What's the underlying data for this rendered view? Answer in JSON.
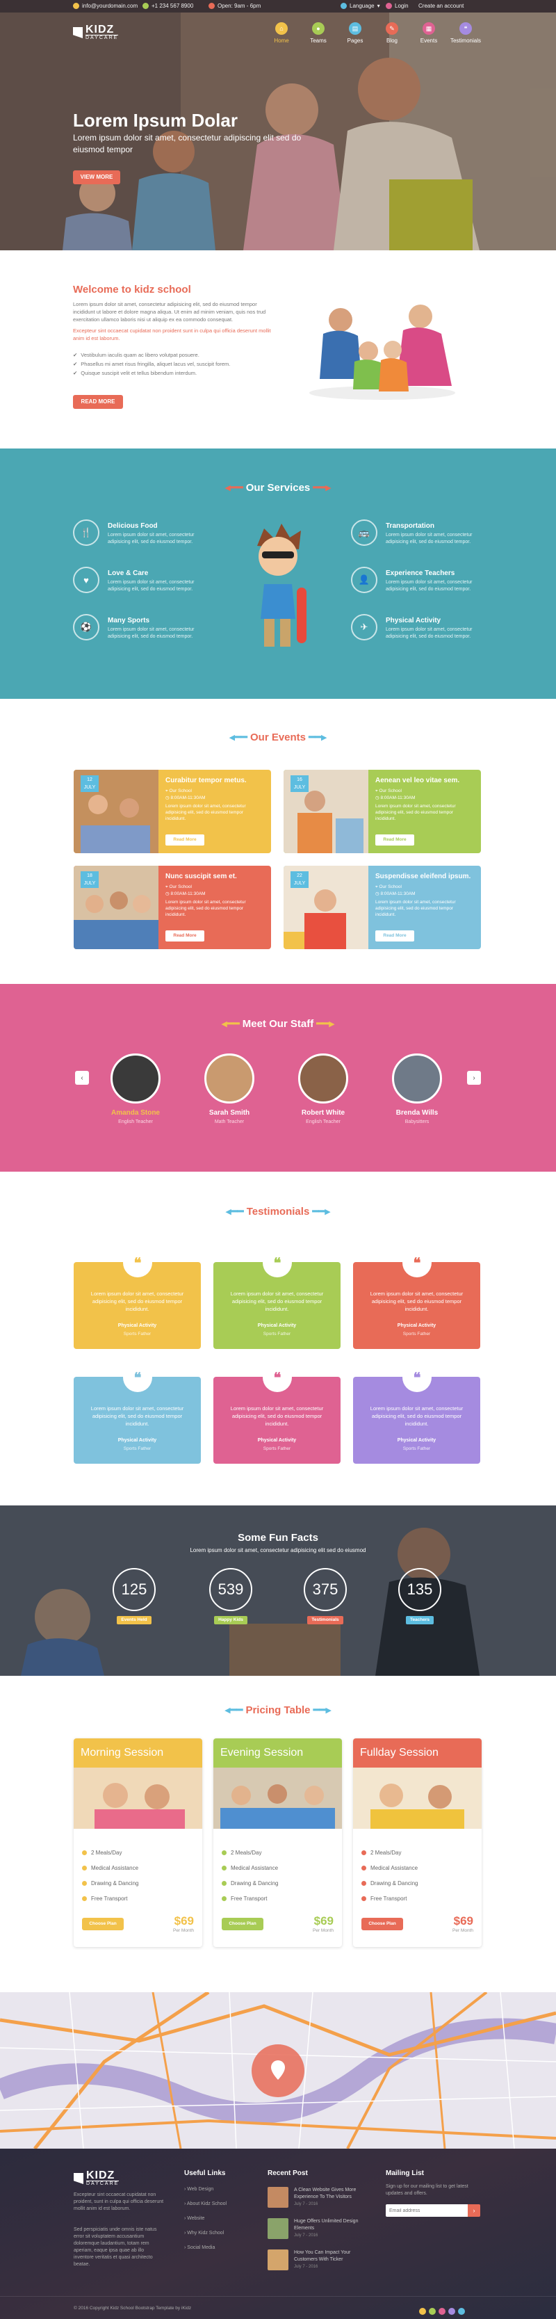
{
  "colors": {
    "red": "#e86b57",
    "teal": "#4ba7b3",
    "pink": "#df6292",
    "yellow": "#f2c24a",
    "green": "#a8cc55",
    "blue": "#7fc2dd",
    "purple": "#a58be0",
    "orange": "#f0a238"
  },
  "topbar": {
    "email": "info@yourdomain.com",
    "phone": "+1 234 567 8900",
    "hours": "Open: 9am - 6pm",
    "language": "Language",
    "login": "Login",
    "create_account": "Create an account"
  },
  "header": {
    "logo_main": "KIDZ",
    "logo_sub": "DAYCARE",
    "nav": [
      {
        "label": "Home",
        "icon": "home-icon"
      },
      {
        "label": "Teams",
        "icon": "users-icon"
      },
      {
        "label": "Pages",
        "icon": "pages-icon"
      },
      {
        "label": "Blog",
        "icon": "blog-icon"
      },
      {
        "label": "Events",
        "icon": "calendar-icon"
      },
      {
        "label": "Testimonials",
        "icon": "quote-icon"
      }
    ]
  },
  "hero": {
    "title": "Lorem Ipsum Dolar",
    "text": "Lorem ipsum dolor sit amet, consectetur adipiscing elit sed do eiusmod tempor",
    "button": "View More"
  },
  "welcome": {
    "title": "Welcome to kidz school",
    "para1": "Lorem ipsum dolor sit amet, consectetur adipisicing elit, sed do eiusmod tempor incididunt ut labore et dolore magna aliqua. Ut enim ad minim veniam, quis nos trud exercitation ullamco laboris nisi ut aliquip ex ea commodo consequat.",
    "para2": "Excepteur sint occaecat cupidatat non proident sunt in culpa qui officia deserunt mollit anim id est laborum.",
    "bullets": [
      "Vestibulum iaculis quam ac libero volutpat posuere.",
      "Phasellus mi amet risus fringilla, aliquet lacus vel, suscipit forem.",
      "Quisque suscipit velit et tellus bibendum interdum."
    ],
    "button": "Read More"
  },
  "services": {
    "title": "Our Services",
    "items": [
      {
        "title": "Delicious Food",
        "desc": "Lorem ipsum dolor sit amet, consectetur adipisicing elit, sed do eiusmod tempor.",
        "icon": "food-icon"
      },
      {
        "title": "Love & Care",
        "desc": "Lorem ipsum dolor sit amet, consectetur adipisicing elit, sed do eiusmod tempor.",
        "icon": "heart-icon"
      },
      {
        "title": "Many Sports",
        "desc": "Lorem ipsum dolor sit amet, consectetur adipisicing elit, sed do eiusmod tempor.",
        "icon": "ball-icon"
      },
      {
        "title": "Transportation",
        "desc": "Lorem ipsum dolor sit amet, consectetur adipisicing elit, sed do eiusmod tempor.",
        "icon": "bus-icon"
      },
      {
        "title": "Experience Teachers",
        "desc": "Lorem ipsum dolor sit amet, consectetur adipisicing elit, sed do eiusmod tempor.",
        "icon": "teacher-icon"
      },
      {
        "title": "Physical Activity",
        "desc": "Lorem ipsum dolor sit amet, consectetur adipisicing elit, sed do eiusmod tempor.",
        "icon": "activity-icon"
      }
    ]
  },
  "events": {
    "title": "Our Events",
    "items": [
      {
        "title": "Curabitur tempor metus.",
        "day": "12",
        "month": "JULY",
        "place": "Our School",
        "time": "8:00AM-11:30AM",
        "desc": "Lorem ipsum dolor sit amet, consectetur adipisicing elit, sed do eiusmod tempor incididunt.",
        "button": "Read More"
      },
      {
        "title": "Aenean vel leo vitae sem.",
        "day": "16",
        "month": "JULY",
        "place": "Our School",
        "time": "8:00AM-11:30AM",
        "desc": "Lorem ipsum dolor sit amet, consectetur adipisicing elit, sed do eiusmod tempor incididunt.",
        "button": "Read More"
      },
      {
        "title": "Nunc suscipit sem et.",
        "day": "18",
        "month": "JULY",
        "place": "Our School",
        "time": "8:00AM-11:30AM",
        "desc": "Lorem ipsum dolor sit amet, consectetur adipisicing elit, sed do eiusmod tempor incididunt.",
        "button": "Read More"
      },
      {
        "title": "Suspendisse eleifend ipsum.",
        "day": "22",
        "month": "JULY",
        "place": "Our School",
        "time": "8:00AM-11:30AM",
        "desc": "Lorem ipsum dolor sit amet, consectetur adipisicing elit, sed do eiusmod tempor incididunt.",
        "button": "Read More"
      }
    ]
  },
  "staff": {
    "title": "Meet Our Staff",
    "prev": "‹",
    "next": "›",
    "members": [
      {
        "name": "Amanda Stone",
        "role": "English Teacher"
      },
      {
        "name": "Sarah Smith",
        "role": "Math Teacher"
      },
      {
        "name": "Robert White",
        "role": "English Teacher"
      },
      {
        "name": "Brenda Wills",
        "role": "Babysitters"
      }
    ]
  },
  "testimonials": {
    "title": "Testimonials",
    "items": [
      {
        "text": "Lorem ipsum dolor sit amet, consectetur adipisicing elit, sed do eiusmod tempor incididunt.",
        "label": "Physical Activity",
        "author": "Sports Father"
      },
      {
        "text": "Lorem ipsum dolor sit amet, consectetur adipisicing elit, sed do eiusmod tempor incididunt.",
        "label": "Physical Activity",
        "author": "Sports Father"
      },
      {
        "text": "Lorem ipsum dolor sit amet, consectetur adipisicing elit, sed do eiusmod tempor incididunt.",
        "label": "Physical Activity",
        "author": "Sports Father"
      },
      {
        "text": "Lorem ipsum dolor sit amet, consectetur adipisicing elit, sed do eiusmod tempor incididunt.",
        "label": "Physical Activity",
        "author": "Sports Father"
      },
      {
        "text": "Lorem ipsum dolor sit amet, consectetur adipisicing elit, sed do eiusmod tempor incididunt.",
        "label": "Physical Activity",
        "author": "Sports Father"
      },
      {
        "text": "Lorem ipsum dolor sit amet, consectetur adipisicing elit, sed do eiusmod tempor incididunt.",
        "label": "Physical Activity",
        "author": "Sports Father"
      }
    ]
  },
  "facts": {
    "title": "Some Fun Facts",
    "subtitle": "Lorem ipsum dolor sit amet, consectetur adipisicing elit sed do eiusmod",
    "items": [
      {
        "value": "125",
        "label": "Events Held"
      },
      {
        "value": "539",
        "label": "Happy Kids"
      },
      {
        "value": "375",
        "label": "Testimonials"
      },
      {
        "value": "135",
        "label": "Teachers"
      }
    ]
  },
  "pricing": {
    "title": "Pricing Table",
    "plans": [
      {
        "name": "Morning Session",
        "features": [
          "2 Meals/Day",
          "Medical Assistance",
          "Drawing & Dancing",
          "Free Transport"
        ],
        "button": "Choose Plan",
        "price": "$69",
        "per": "Per Month"
      },
      {
        "name": "Evening Session",
        "features": [
          "2 Meals/Day",
          "Medical Assistance",
          "Drawing & Dancing",
          "Free Transport"
        ],
        "button": "Choose Plan",
        "price": "$69",
        "per": "Per Month"
      },
      {
        "name": "Fullday Session",
        "features": [
          "2 Meals/Day",
          "Medical Assistance",
          "Drawing & Dancing",
          "Free Transport"
        ],
        "button": "Choose Plan",
        "price": "$69",
        "per": "Per Month"
      }
    ]
  },
  "footer": {
    "logo_main": "KIDZ",
    "logo_sub": "DAYCARE",
    "about1": "Excepteur sint occaecat cupidatat non proident, sunt in culpa qui officia deserunt mollit anim id est laborum.",
    "about2": "Sed perspiciatis unde omnis iste natus error sit voluptatem accusantium doloremque laudantium, totam rem aperiam, eaque ipsa quae ab illo inventore veritatis et quasi architecto beatae.",
    "links_title": "Useful Links",
    "links": [
      "Web Design",
      "About Kidz School",
      "Website",
      "Why Kidz School",
      "Social Media"
    ],
    "posts_title": "Recent Post",
    "posts": [
      {
        "title": "A Clean Website Gives More Experience To The Visitors",
        "date": "July 7 - 2016"
      },
      {
        "title": "Huge Offers Unlimited Design Elements",
        "date": "July 7 - 2016"
      },
      {
        "title": "How You Can Impact Your Customers With Ticker",
        "date": "July 7 - 2016"
      }
    ],
    "mail_title": "Mailing List",
    "mail_text": "Sign up for our mailing list to get latest updates and offers.",
    "mail_placeholder": "Email address",
    "copyright": "© 2016 Copyright Kidz School Bootstrap Template by iKidz"
  }
}
